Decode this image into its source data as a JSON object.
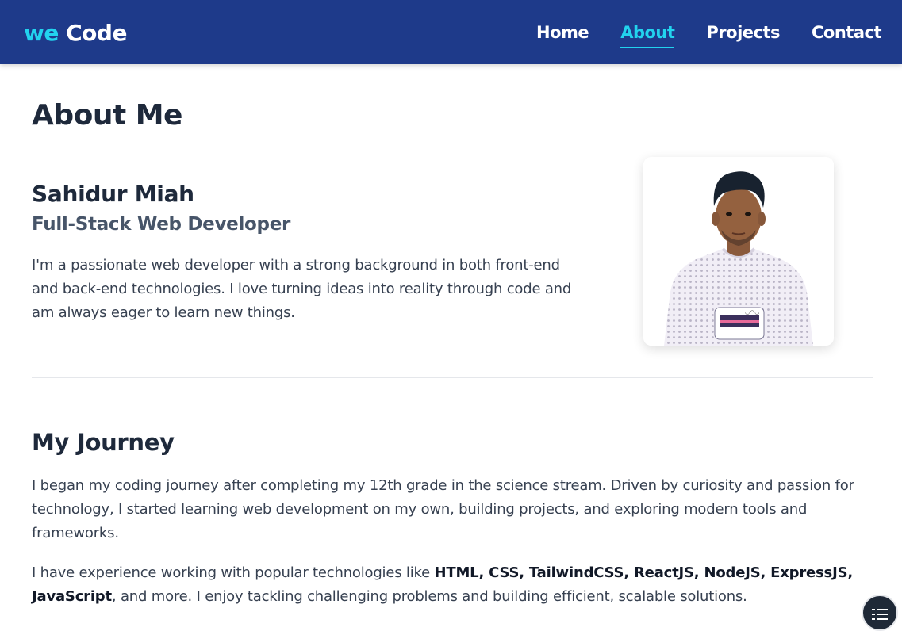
{
  "navbar": {
    "logo_we": "we",
    "logo_code": "Code",
    "links": [
      {
        "label": "Home",
        "active": false
      },
      {
        "label": "About",
        "active": true
      },
      {
        "label": "Projects",
        "active": false
      },
      {
        "label": "Contact",
        "active": false
      }
    ],
    "accent_color": "#22d3ee",
    "background_color": "#1e3a8a"
  },
  "about": {
    "title": "About Me",
    "name": "Sahidur Miah",
    "role": "Full-Stack Web Developer",
    "bio": "I'm a passionate web developer with a strong background in both front-end and back-end technologies. I love turning ideas into reality through code and am always eager to learn new things.",
    "photo_icon": "profile-photo"
  },
  "journey": {
    "title": "My Journey",
    "paragraph1": "I began my coding journey after completing my 12th grade in the science stream. Driven by curiosity and passion for technology, I started learning web development on my own, building projects, and exploring modern tools and frameworks.",
    "paragraph2_prefix": "I have experience working with popular technologies like ",
    "paragraph2_technologies": "HTML, CSS, TailwindCSS, ReactJS, NodeJS, ExpressJS, JavaScript",
    "paragraph2_suffix": ", and more. I enjoy tackling challenging problems and building efficient, scalable solutions."
  },
  "floating_button": {
    "icon": "list-menu-icon"
  }
}
